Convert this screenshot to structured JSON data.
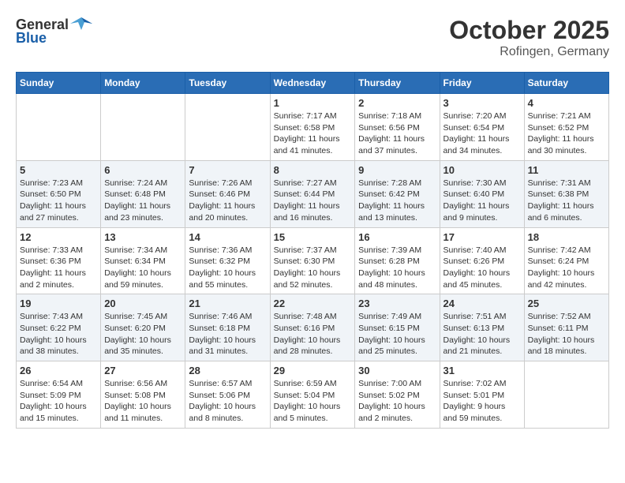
{
  "header": {
    "logo_general": "General",
    "logo_blue": "Blue",
    "month": "October 2025",
    "location": "Rofingen, Germany"
  },
  "days_of_week": [
    "Sunday",
    "Monday",
    "Tuesday",
    "Wednesday",
    "Thursday",
    "Friday",
    "Saturday"
  ],
  "weeks": [
    {
      "days": [
        {
          "number": "",
          "info": ""
        },
        {
          "number": "",
          "info": ""
        },
        {
          "number": "",
          "info": ""
        },
        {
          "number": "1",
          "info": "Sunrise: 7:17 AM\nSunset: 6:58 PM\nDaylight: 11 hours\nand 41 minutes."
        },
        {
          "number": "2",
          "info": "Sunrise: 7:18 AM\nSunset: 6:56 PM\nDaylight: 11 hours\nand 37 minutes."
        },
        {
          "number": "3",
          "info": "Sunrise: 7:20 AM\nSunset: 6:54 PM\nDaylight: 11 hours\nand 34 minutes."
        },
        {
          "number": "4",
          "info": "Sunrise: 7:21 AM\nSunset: 6:52 PM\nDaylight: 11 hours\nand 30 minutes."
        }
      ]
    },
    {
      "days": [
        {
          "number": "5",
          "info": "Sunrise: 7:23 AM\nSunset: 6:50 PM\nDaylight: 11 hours\nand 27 minutes."
        },
        {
          "number": "6",
          "info": "Sunrise: 7:24 AM\nSunset: 6:48 PM\nDaylight: 11 hours\nand 23 minutes."
        },
        {
          "number": "7",
          "info": "Sunrise: 7:26 AM\nSunset: 6:46 PM\nDaylight: 11 hours\nand 20 minutes."
        },
        {
          "number": "8",
          "info": "Sunrise: 7:27 AM\nSunset: 6:44 PM\nDaylight: 11 hours\nand 16 minutes."
        },
        {
          "number": "9",
          "info": "Sunrise: 7:28 AM\nSunset: 6:42 PM\nDaylight: 11 hours\nand 13 minutes."
        },
        {
          "number": "10",
          "info": "Sunrise: 7:30 AM\nSunset: 6:40 PM\nDaylight: 11 hours\nand 9 minutes."
        },
        {
          "number": "11",
          "info": "Sunrise: 7:31 AM\nSunset: 6:38 PM\nDaylight: 11 hours\nand 6 minutes."
        }
      ]
    },
    {
      "days": [
        {
          "number": "12",
          "info": "Sunrise: 7:33 AM\nSunset: 6:36 PM\nDaylight: 11 hours\nand 2 minutes."
        },
        {
          "number": "13",
          "info": "Sunrise: 7:34 AM\nSunset: 6:34 PM\nDaylight: 10 hours\nand 59 minutes."
        },
        {
          "number": "14",
          "info": "Sunrise: 7:36 AM\nSunset: 6:32 PM\nDaylight: 10 hours\nand 55 minutes."
        },
        {
          "number": "15",
          "info": "Sunrise: 7:37 AM\nSunset: 6:30 PM\nDaylight: 10 hours\nand 52 minutes."
        },
        {
          "number": "16",
          "info": "Sunrise: 7:39 AM\nSunset: 6:28 PM\nDaylight: 10 hours\nand 48 minutes."
        },
        {
          "number": "17",
          "info": "Sunrise: 7:40 AM\nSunset: 6:26 PM\nDaylight: 10 hours\nand 45 minutes."
        },
        {
          "number": "18",
          "info": "Sunrise: 7:42 AM\nSunset: 6:24 PM\nDaylight: 10 hours\nand 42 minutes."
        }
      ]
    },
    {
      "days": [
        {
          "number": "19",
          "info": "Sunrise: 7:43 AM\nSunset: 6:22 PM\nDaylight: 10 hours\nand 38 minutes."
        },
        {
          "number": "20",
          "info": "Sunrise: 7:45 AM\nSunset: 6:20 PM\nDaylight: 10 hours\nand 35 minutes."
        },
        {
          "number": "21",
          "info": "Sunrise: 7:46 AM\nSunset: 6:18 PM\nDaylight: 10 hours\nand 31 minutes."
        },
        {
          "number": "22",
          "info": "Sunrise: 7:48 AM\nSunset: 6:16 PM\nDaylight: 10 hours\nand 28 minutes."
        },
        {
          "number": "23",
          "info": "Sunrise: 7:49 AM\nSunset: 6:15 PM\nDaylight: 10 hours\nand 25 minutes."
        },
        {
          "number": "24",
          "info": "Sunrise: 7:51 AM\nSunset: 6:13 PM\nDaylight: 10 hours\nand 21 minutes."
        },
        {
          "number": "25",
          "info": "Sunrise: 7:52 AM\nSunset: 6:11 PM\nDaylight: 10 hours\nand 18 minutes."
        }
      ]
    },
    {
      "days": [
        {
          "number": "26",
          "info": "Sunrise: 6:54 AM\nSunset: 5:09 PM\nDaylight: 10 hours\nand 15 minutes."
        },
        {
          "number": "27",
          "info": "Sunrise: 6:56 AM\nSunset: 5:08 PM\nDaylight: 10 hours\nand 11 minutes."
        },
        {
          "number": "28",
          "info": "Sunrise: 6:57 AM\nSunset: 5:06 PM\nDaylight: 10 hours\nand 8 minutes."
        },
        {
          "number": "29",
          "info": "Sunrise: 6:59 AM\nSunset: 5:04 PM\nDaylight: 10 hours\nand 5 minutes."
        },
        {
          "number": "30",
          "info": "Sunrise: 7:00 AM\nSunset: 5:02 PM\nDaylight: 10 hours\nand 2 minutes."
        },
        {
          "number": "31",
          "info": "Sunrise: 7:02 AM\nSunset: 5:01 PM\nDaylight: 9 hours\nand 59 minutes."
        },
        {
          "number": "",
          "info": ""
        }
      ]
    }
  ]
}
